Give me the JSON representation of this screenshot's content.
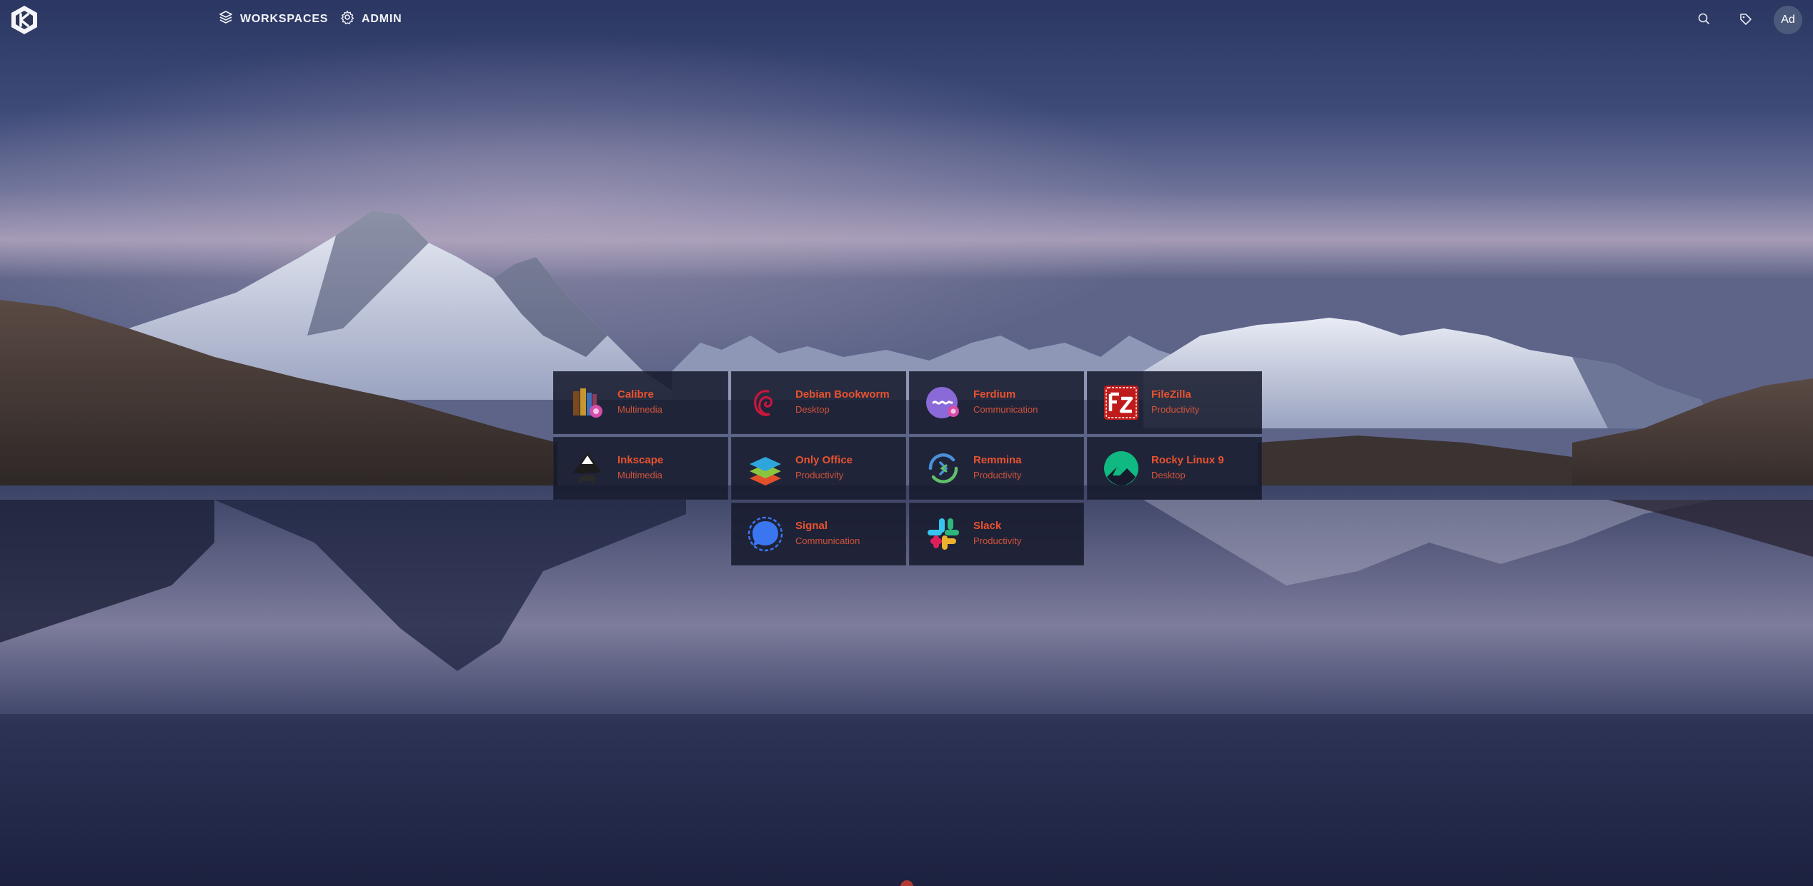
{
  "nav": {
    "workspaces_label": "WORKSPACES",
    "admin_label": "ADMIN",
    "avatar_text": "Ad"
  },
  "colors": {
    "accent": "#e8522f",
    "tile_bg": "#161a2c",
    "nav_text": "#f2f4f8",
    "avatar_bg": "#4b5a7b"
  },
  "workspaces": [
    {
      "name": "Calibre",
      "category": "Multimedia",
      "icon": "calibre-icon"
    },
    {
      "name": "Debian Bookworm",
      "category": "Desktop",
      "icon": "debian-icon"
    },
    {
      "name": "Ferdium",
      "category": "Communication",
      "icon": "ferdium-icon"
    },
    {
      "name": "FileZilla",
      "category": "Productivity",
      "icon": "filezilla-icon"
    },
    {
      "name": "Inkscape",
      "category": "Multimedia",
      "icon": "inkscape-icon"
    },
    {
      "name": "Only Office",
      "category": "Productivity",
      "icon": "onlyoffice-icon"
    },
    {
      "name": "Remmina",
      "category": "Productivity",
      "icon": "remmina-icon"
    },
    {
      "name": "Rocky Linux 9",
      "category": "Desktop",
      "icon": "rocky-linux-icon"
    },
    {
      "name": "Signal",
      "category": "Communication",
      "icon": "signal-icon"
    },
    {
      "name": "Slack",
      "category": "Productivity",
      "icon": "slack-icon"
    }
  ]
}
